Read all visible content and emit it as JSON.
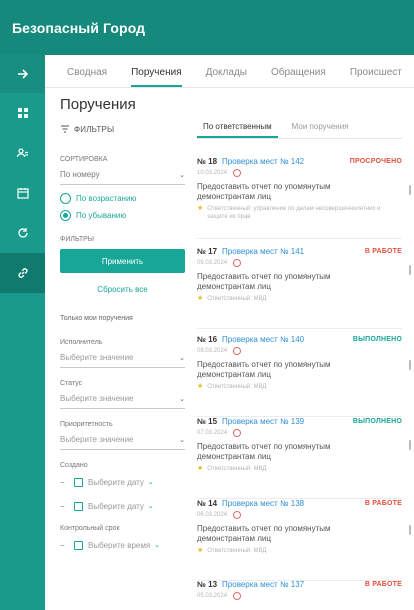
{
  "app": {
    "title": "Безопасный Город"
  },
  "rail": {
    "items": [
      {
        "name": "arrow-right-icon"
      },
      {
        "name": "dashboard-icon"
      },
      {
        "name": "users-icon"
      },
      {
        "name": "calendar-icon"
      },
      {
        "name": "refresh-icon"
      },
      {
        "name": "link-icon"
      }
    ]
  },
  "tabs": [
    {
      "label": "Сводная"
    },
    {
      "label": "Поручения"
    },
    {
      "label": "Доклады"
    },
    {
      "label": "Обращения"
    },
    {
      "label": "Происшест"
    }
  ],
  "left": {
    "title": "Поручения",
    "filters_label": "ФИЛЬТРЫ",
    "sort_label": "СОРТИРОВКА",
    "sort_value": "По номеру",
    "radio_asc": "По возрастанию",
    "radio_desc": "По убыванию",
    "filters_section": "ФИЛЬТРЫ",
    "apply_label": "Применить",
    "reset_label": "Сбросить все",
    "only_mine": "Только мои поручения",
    "executor_label": "Исполнитель",
    "executor_placeholder": "Выберите значение",
    "status_label": "Статус",
    "status_placeholder": "Выберите значение",
    "priority_label": "Приоритетность",
    "priority_placeholder": "Выберите значение",
    "created_label": "Создано",
    "created_from": "Выберите дату",
    "created_to": "Выберите дату",
    "deadline_label": "Контрольный срок",
    "deadline_from": "Выберите время"
  },
  "subtabs": [
    {
      "label": "По ответственным"
    },
    {
      "label": "Мои поручения"
    }
  ],
  "cards": [
    {
      "num": "№ 18",
      "link": "Проверка мест № 142",
      "status": "ПРОСРОЧЕНО",
      "status_color": "#e0513f",
      "date": "10.03.2024",
      "text": "Предоставить отчет по упомянутым демонстрантам лиц",
      "meta": "Ответственный: управление по делам несовершеннолетних и защите их прав"
    },
    {
      "num": "№ 17",
      "link": "Проверка мест № 141",
      "status": "В РАБОТЕ",
      "status_color": "#e0513f",
      "date": "09.03.2024",
      "text": "Предоставить отчет по упомянутым демонстрантам лиц",
      "meta": "Ответственный: МВД"
    },
    {
      "num": "№ 16",
      "link": "Проверка мест № 140",
      "status": "ВЫПОЛНЕНО",
      "status_color": "#17a697",
      "date": "08.03.2024",
      "text": "Предоставить отчет по упомянутым демонстрантам лиц",
      "meta": "Ответственный: МВД"
    },
    {
      "num": "№ 15",
      "link": "Проверка мест № 139",
      "status": "ВЫПОЛНЕНО",
      "status_color": "#17a697",
      "date": "07.03.2024",
      "text": "Предоставить отчет по упомянутым демонстрантам лиц",
      "meta": "Ответственный: МВД"
    },
    {
      "num": "№ 14",
      "link": "Проверка мест № 138",
      "status": "В РАБОТЕ",
      "status_color": "#e0513f",
      "date": "06.03.2024",
      "text": "Предоставить отчет по упомянутым демонстрантам лиц",
      "meta": "Ответственный: МВД"
    },
    {
      "num": "№ 13",
      "link": "Проверка мест № 137",
      "status": "В РАБОТЕ",
      "status_color": "#e0513f",
      "date": "05.03.2024",
      "text": "",
      "meta": ""
    }
  ]
}
